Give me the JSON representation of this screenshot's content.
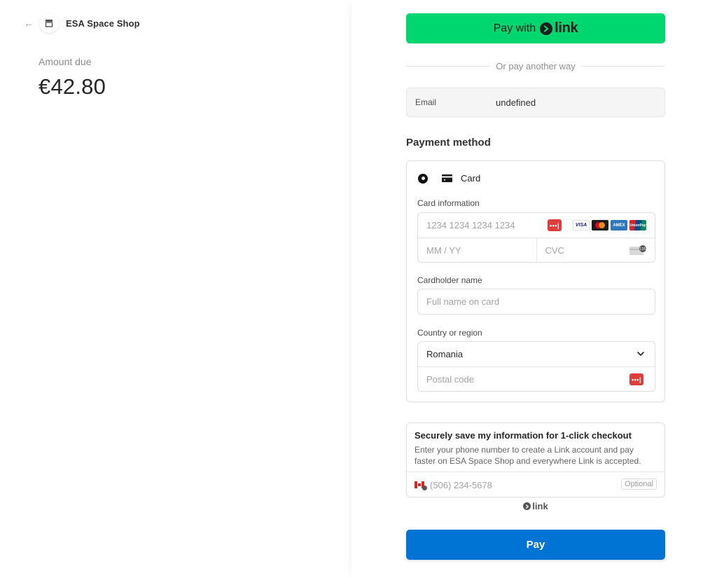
{
  "merchant": {
    "name": "ESA Space Shop",
    "back_icon": "arrow-left-icon",
    "store_icon": "storefront-icon"
  },
  "summary": {
    "amount_label": "Amount due",
    "amount": "€42.80"
  },
  "express": {
    "pay_with_label": "Pay with",
    "link_word": "link",
    "brand_color": "#00d66f"
  },
  "divider": {
    "text": "Or pay another way"
  },
  "email": {
    "label": "Email",
    "value": "undefined"
  },
  "payment_method": {
    "title": "Payment method",
    "option_label": "Card",
    "option_selected": true,
    "card_info": {
      "label": "Card information",
      "number_placeholder": "1234 1234 1234 1234",
      "expiry_placeholder": "MM / YY",
      "cvc_placeholder": "CVC",
      "password_manager_glyph": "•••|",
      "brands": [
        "VISA",
        "Mastercard",
        "American Express",
        "UnionPay"
      ],
      "visa_text": "VISA",
      "amex_text": "AMEX",
      "unionpay_text": "UnionPay"
    },
    "cardholder": {
      "label": "Cardholder name",
      "placeholder": "Full name on card"
    },
    "country": {
      "label": "Country or region",
      "selected": "Romania",
      "postal_placeholder": "Postal code"
    }
  },
  "link_save": {
    "title": "Securely save my information for 1-click checkout",
    "description": "Enter your phone number to create a Link account and pay faster on ESA Space Shop and everywhere Link is accepted.",
    "phone_placeholder": "(506) 234-5678",
    "optional_label": "Optional",
    "footer_link_word": "link"
  },
  "pay_button": {
    "label": "Pay",
    "color": "#0074d4"
  }
}
